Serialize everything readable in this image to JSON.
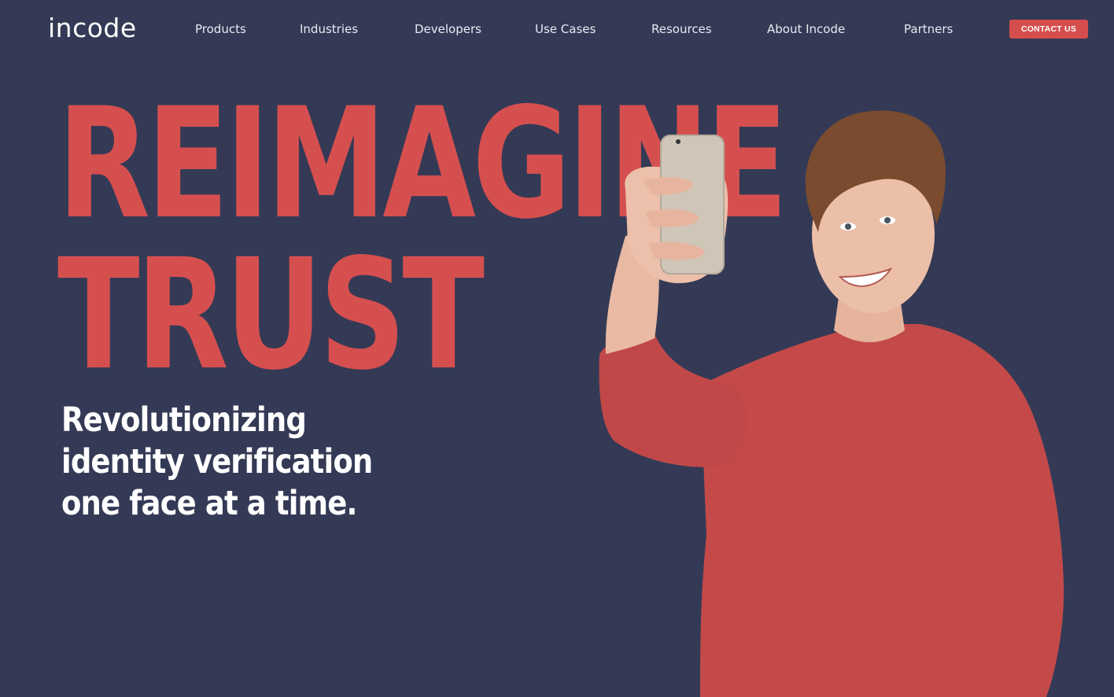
{
  "header": {
    "logo_text": "incode",
    "nav": [
      {
        "label": "Products"
      },
      {
        "label": "Industries"
      },
      {
        "label": "Developers"
      },
      {
        "label": "Use Cases"
      },
      {
        "label": "Resources"
      },
      {
        "label": "About Incode"
      },
      {
        "label": "Partners"
      }
    ],
    "contact_label": "CONTACT US"
  },
  "hero": {
    "headline_line1": "REIMAGINE",
    "headline_line2": "TRUST",
    "subheadline": "Revolutionizing identity verification one face at a time.",
    "image_icon": "person-taking-selfie-photo"
  },
  "colors": {
    "background": "#343a55",
    "accent": "#d64d4d",
    "text": "#ffffff"
  }
}
